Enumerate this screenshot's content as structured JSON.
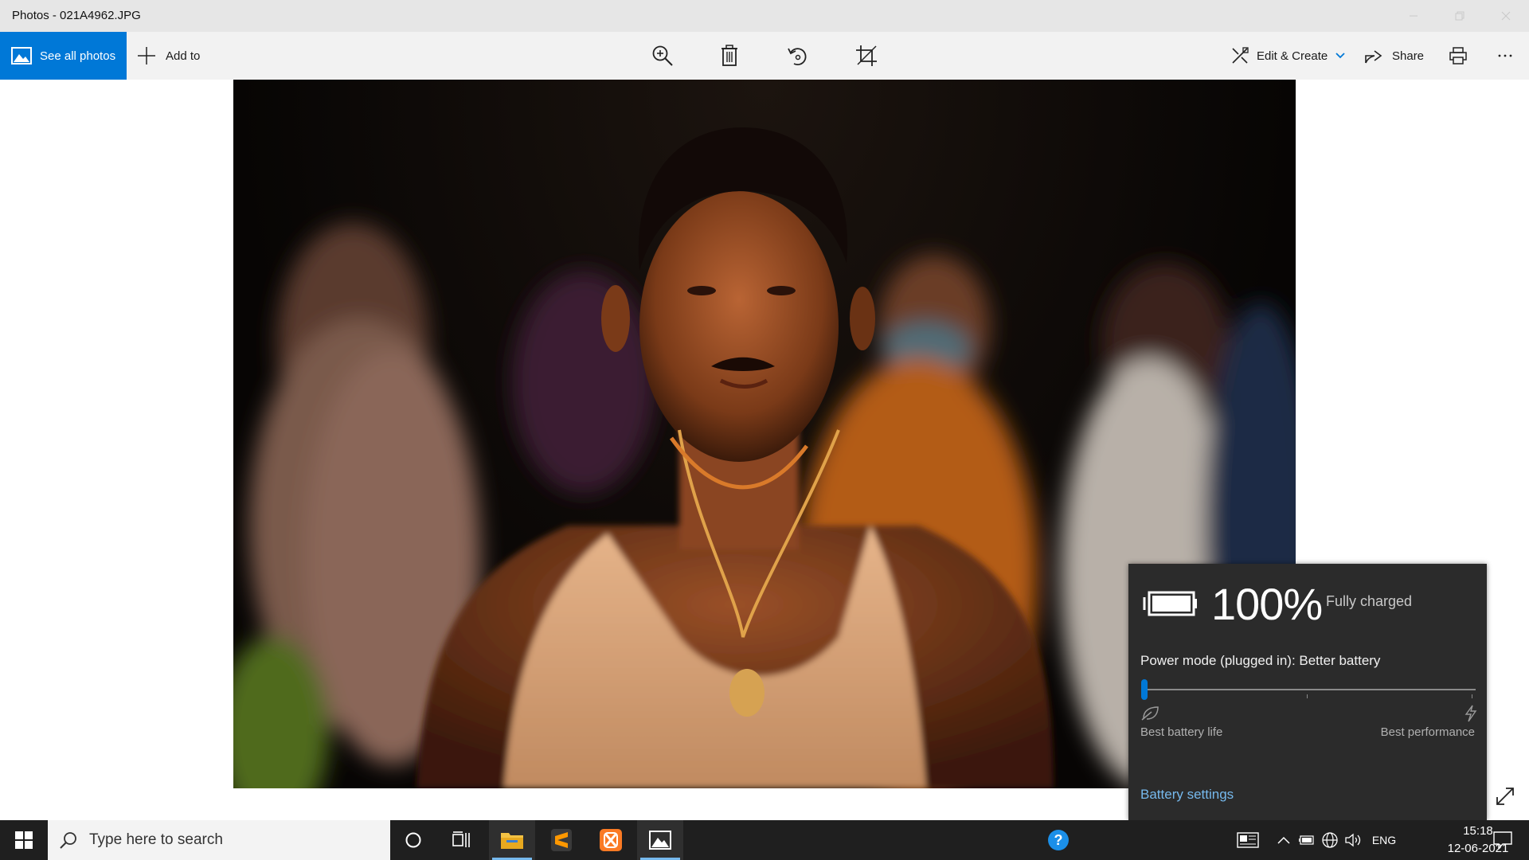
{
  "window": {
    "title": "Photos - 021A4962.JPG"
  },
  "toolbar": {
    "see_all_label": "See all photos",
    "add_to_label": "Add to",
    "edit_create_label": "Edit & Create",
    "share_label": "Share"
  },
  "battery_flyout": {
    "percent": "100%",
    "status": "Fully charged",
    "power_mode": "Power mode (plugged in): Better battery",
    "slider_value": 0,
    "left_label": "Best battery life",
    "right_label": "Best performance",
    "settings_link": "Battery settings"
  },
  "taskbar": {
    "search_placeholder": "Type here to search",
    "language": "ENG",
    "time": "15:18",
    "date": "12-06-2021"
  },
  "colors": {
    "accent": "#0078d7",
    "link": "#76b9ed",
    "flyout_bg": "#2b2b2b",
    "taskbar_bg": "#1f1f1f"
  }
}
